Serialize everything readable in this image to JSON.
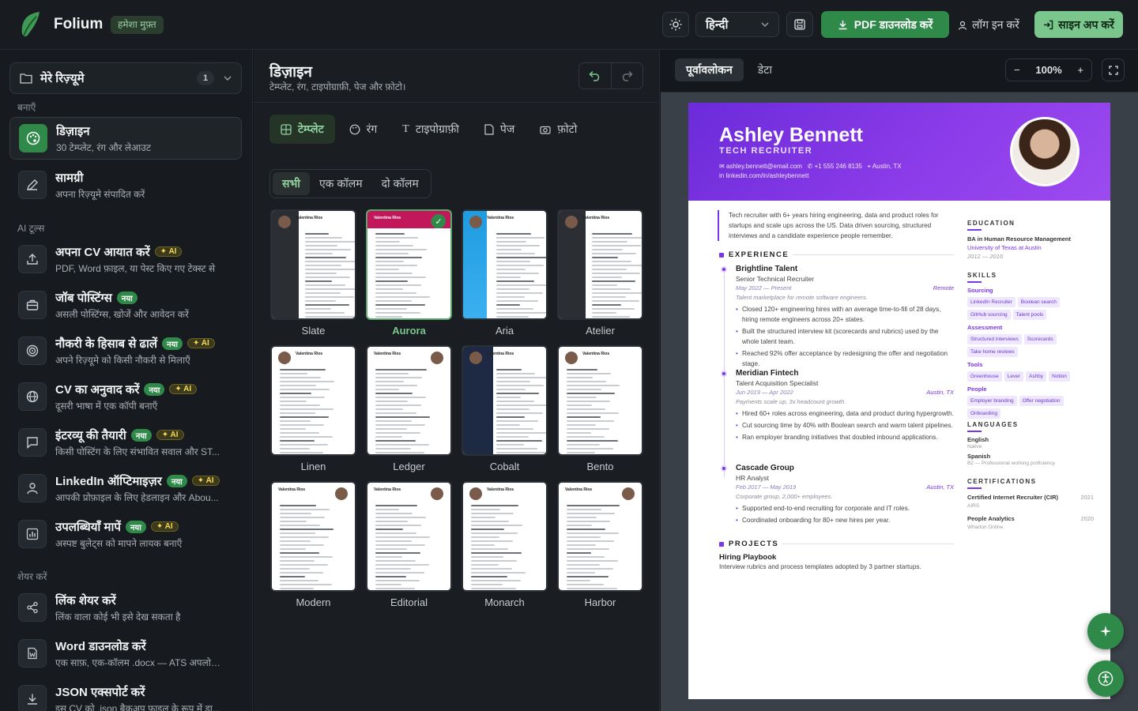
{
  "topbar": {
    "brand": "Folium",
    "free_badge": "हमेशा मुफ़्त",
    "language": "हिन्दी",
    "pdf_button": "PDF डाउनलोड करें",
    "login": "लॉग इन करें",
    "signup": "साइन अप करें"
  },
  "sidebar": {
    "resume_select": "मेरे रिज़्यूमे",
    "resume_count": "1",
    "section_create": "बनाएँ",
    "section_ai": "AI टूल्स",
    "section_share": "शेयर करें",
    "items": [
      {
        "title": "डिज़ाइन",
        "sub": "30 टेम्प्लेट, रंग और लेआउट"
      },
      {
        "title": "सामग्री",
        "sub": "अपना रिज़्यूमे संपादित करें"
      },
      {
        "title": "अपना CV आयात करें",
        "sub": "PDF, Word फ़ाइल, या पेस्ट किए गए टेक्स्ट से",
        "ai": "AI"
      },
      {
        "title": "जॉब पोस्टिंग्स",
        "sub": "असली पोस्टिंग्स, खोजें और आवेदन करें",
        "new": "नया"
      },
      {
        "title": "नौकरी के हिसाब से ढालें",
        "sub": "अपने रिज़्यूमे को किसी नौकरी से मिलाएँ",
        "new": "नया",
        "ai": "AI"
      },
      {
        "title": "CV का अनुवाद करें",
        "sub": "दूसरी भाषा में एक कॉपी बनाएँ",
        "new": "नया",
        "ai": "AI"
      },
      {
        "title": "इंटरव्यू की तैयारी",
        "sub": "किसी पोस्टिंग के लिए संभावित सवाल और ST...",
        "new": "नया",
        "ai": "AI"
      },
      {
        "title": "LinkedIn ऑप्टिमाइज़र",
        "sub": "आपकी प्रोफ़ाइल के लिए हेडलाइन और Abou...",
        "new": "नया",
        "ai": "AI"
      },
      {
        "title": "उपलब्धियाँ मापें",
        "sub": "अस्पष्ट बुलेट्स को मापने लायक बनाएँ",
        "new": "नया",
        "ai": "AI"
      },
      {
        "title": "लिंक शेयर करें",
        "sub": "लिंक वाला कोई भी इसे देख सकता है"
      },
      {
        "title": "Word डाउनलोड करें",
        "sub": "एक साफ़, एक-कॉलम .docx — ATS अपलोड..."
      },
      {
        "title": "JSON एक्सपोर्ट करें",
        "sub": "इस CV को .json बैकअप फ़ाइल के रूप में डा..."
      }
    ]
  },
  "design": {
    "title": "डिज़ाइन",
    "subtitle": "टेम्प्लेट, रंग, टाइपोग्राफ़ी, पेज और फ़ोटो।",
    "tabs": [
      "टेम्प्लेट",
      "रंग",
      "टाइपोग्राफ़ी",
      "पेज",
      "फ़ोटो"
    ],
    "filters": [
      "सभी",
      "एक कॉलम",
      "दो कॉलम"
    ],
    "templates": [
      "Slate",
      "Aurora",
      "Aria",
      "Atelier",
      "Linen",
      "Ledger",
      "Cobalt",
      "Bento",
      "Modern",
      "Editorial",
      "Monarch",
      "Harbor"
    ],
    "selected_template": "Aurora",
    "thumb_name": "Valentina Rios"
  },
  "preview": {
    "tabs": [
      "पूर्वावलोकन",
      "डेटा"
    ],
    "zoom": "100%",
    "zoom_minus": "−",
    "zoom_plus": "+"
  },
  "resume": {
    "name": "Ashley Bennett",
    "role": "TECH RECRUITER",
    "email": "ashley.bennett@email.com",
    "phone": "+1 555 246 8135",
    "location": "Austin, TX",
    "linkedin": "linkedin.com/in/ashleybennett",
    "summary_html": "Tech recruiter with 6+ years hiring engineering, data and product roles for startups and scale ups across the US. Data driven sourcing, structured interviews and a candidate experience people remember.",
    "experience_heading": "EXPERIENCE",
    "jobs": [
      {
        "company": "Brightline Talent",
        "title": "Senior Technical Recruiter",
        "dates": "May 2022 — Present",
        "location": "Remote",
        "desc": "Talent marketplace for remote software engineers.",
        "bullets": [
          "Closed 120+ engineering hires with an average time-to-fill of 28 days, hiring remote engineers across 20+ states.",
          "Built the structured interview kit (scorecards and rubrics) used by the whole talent team.",
          "Reached 92% offer acceptance by redesigning the offer and negotiation stage."
        ]
      },
      {
        "company": "Meridian Fintech",
        "title": "Talent Acquisition Specialist",
        "dates": "Jun 2019 — Apr 2022",
        "location": "Austin, TX",
        "desc": "Payments scale up, 3x headcount growth.",
        "bullets": [
          "Hired 60+ roles across engineering, data and product during hypergrowth.",
          "Cut sourcing time by 40% with Boolean search and warm talent pipelines.",
          "Ran employer branding initiatives that doubled inbound applications."
        ]
      },
      {
        "company": "Cascade Group",
        "title": "HR Analyst",
        "dates": "Feb 2017 — May 2019",
        "location": "Austin, TX",
        "desc": "Corporate group, 2,000+ employees.",
        "bullets": [
          "Supported end-to-end recruiting for corporate and IT roles.",
          "Coordinated onboarding for 80+ new hires per year."
        ]
      }
    ],
    "projects_heading": "PROJECTS",
    "project_name": "Hiring Playbook",
    "project_desc": "Interview rubrics and process templates adopted by 3 partner startups.",
    "education_heading": "EDUCATION",
    "degree": "BA in Human Resource Management",
    "school": "University of Texas at Austin",
    "edu_dates": "2012 — 2016",
    "skills_heading": "SKILLS",
    "skill_groups": [
      {
        "name": "Sourcing",
        "chips": [
          "LinkedIn Recruiter",
          "Boolean search",
          "GitHub sourcing",
          "Talent pools"
        ]
      },
      {
        "name": "Assessment",
        "chips": [
          "Structured interviews",
          "Scorecards",
          "Take home reviews"
        ]
      },
      {
        "name": "Tools",
        "chips": [
          "Greenhouse",
          "Lever",
          "Ashby",
          "Notion"
        ]
      },
      {
        "name": "People",
        "chips": [
          "Employer branding",
          "Offer negotiation",
          "Onboarding"
        ]
      }
    ],
    "languages_heading": "LANGUAGES",
    "languages": [
      {
        "name": "English",
        "level": "Native"
      },
      {
        "name": "Spanish",
        "level": "B2 — Professional working proficiency"
      }
    ],
    "certifications_heading": "CERTIFICATIONS",
    "certs": [
      {
        "name": "Certified Internet Recruiter (CIR)",
        "org": "AIRS",
        "year": "2021"
      },
      {
        "name": "People Analytics",
        "org": "Wharton Online",
        "year": "2020"
      }
    ]
  },
  "colors": {
    "accent": "#2f8a4a",
    "resume_accent": "#7a35e6"
  }
}
